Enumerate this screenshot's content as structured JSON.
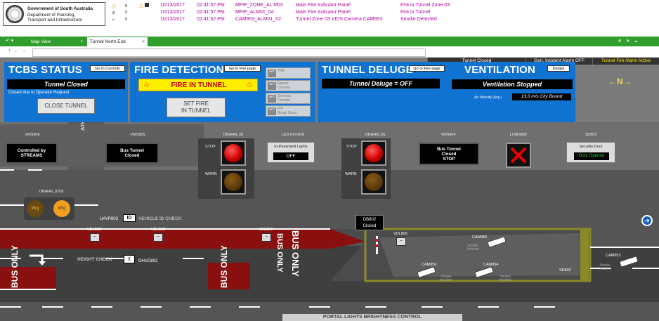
{
  "header": {
    "logo_lines": [
      "Government of South Australia",
      "Department of Planning,",
      "Transport and Infrastructure"
    ],
    "alarm_counts": [
      "6",
      "0",
      "0"
    ],
    "alarms": [
      {
        "date": "10/13/2017",
        "time": "02:41:57 PM",
        "source": "MFIP_ZONE_AL M03",
        "panel": "Main Fire Indicator Panel",
        "desc": "Fire in Tunnel Zone 03"
      },
      {
        "date": "10/13/2017",
        "time": "02:41:57 PM",
        "source": "MFIP_ALM01_04",
        "panel": "Main Fire Indicator Panel",
        "desc": "Fire in Tunnel"
      },
      {
        "date": "10/13/2017",
        "time": "02:41:52 PM",
        "source": "CAM953_ALM01_02",
        "panel": "Tunnel Zone 03 VIDS Camera CAM953",
        "desc": "Smoke Detected"
      }
    ]
  },
  "tabs": [
    {
      "label": "Map View",
      "close": "×"
    },
    {
      "label": "Tunnel North End",
      "close": "×"
    }
  ],
  "nav": {
    "back": "↶ ▾",
    "arrows": "«   »   ⌄",
    "addr_nav": "↑  ←  →"
  },
  "status_bar": [
    "Tunnel Closed",
    "Gen. Incident Alarm OFF",
    "Tunnel Fire Alarm Active"
  ],
  "tcbs": {
    "title": "TCBS STATUS",
    "goto": "Go to Controls",
    "display": "Tunnel Closed",
    "note": "Closed due to Operator Request",
    "button": "CLOSE TUNNEL"
  },
  "fire": {
    "title": "FIRE DETECTION",
    "goto": "Go to Fire page",
    "display": "FIRE IN TUNNEL",
    "button_l1": "SET FIRE",
    "button_l2": "IN TUNNEL",
    "items": [
      {
        "icon": "NFP",
        "l1": "TSR",
        "l2": ""
      },
      {
        "icon": "NFP",
        "l1": "Egress",
        "l2": "Corridor"
      },
      {
        "icon": "NFP",
        "l1": "Services",
        "l2": "Corridor"
      },
      {
        "icon": "NFP",
        "l1": "FIP",
        "l2": "Break Glass"
      }
    ]
  },
  "deluge": {
    "title": "TUNNEL DELUGE",
    "goto": "Go to Fire page",
    "display": "Tunnel Deluge = OFF"
  },
  "ventilation": {
    "title": "VENTILATION",
    "details": "Details",
    "display": "Ventilation Stopped",
    "air_label": "Air Velocity (Avg.)",
    "air_value": "13.0 m/s City Bound"
  },
  "compass": "←N→",
  "road": {
    "vms906": {
      "label": "VMS906",
      "l1": "Controlled by",
      "l2": "STREAMS"
    },
    "vms905": {
      "label": "VMS905",
      "l1": "Bus Tunnel",
      "l2": "Closed"
    },
    "vms904": {
      "label": "VMS904",
      "l1": "Bus Tunnel",
      "l2": "Closed",
      "l3": "STOP"
    },
    "obahn06": {
      "label": "OBAHN_06",
      "stop": "STOP",
      "warn": "WARN"
    },
    "obahn05": {
      "label": "OBAHN_05",
      "stop": "STOP",
      "warn": "WARN"
    },
    "led": {
      "label": "LED 814-828",
      "title": "In-Pavement Lights",
      "value": "OFF"
    },
    "lums": {
      "label": "LUMS802"
    },
    "sd": {
      "label": "SD802",
      "title": "Security Door",
      "value": "Door Opened"
    },
    "obahn0708": {
      "label": "OBAHN_0708",
      "l": "Wrg",
      "r": "Wrg"
    },
    "athelney": "ATHENLEY DRIVE",
    "vid_check": "VEHICLE ID CHECK",
    "uavp": "UAVP802",
    "id": "ID",
    "height_check": "HEIGHT CHECK",
    "ohvd": "OHVD802",
    "bus_only": "BUS ONLY",
    "db": {
      "l1": "DB802",
      "l2": "Closed"
    },
    "vdl": [
      "VDL809",
      "VDL808",
      "VDL807",
      "VDL806"
    ],
    "cams": [
      {
        "label": "CAM955",
        "smoke": "Smoke Incident"
      },
      {
        "label": "CAM956",
        "smoke": "Smoke Incident"
      },
      {
        "label": "CAM954",
        "smoke": "Smoke Incident"
      },
      {
        "label": "CAM953",
        "smoke": "Smoke Incident"
      }
    ],
    "sd892": "SD892",
    "portal": "PORTAL LIGHTS BRIGHTNESS CONTROL"
  },
  "colors": {
    "panel_blue": "#1173d1",
    "alarm_magenta": "#b0009c",
    "fire_yellow": "#ffee00",
    "stop_red": "#d00000",
    "road_red": "#8a1010"
  }
}
